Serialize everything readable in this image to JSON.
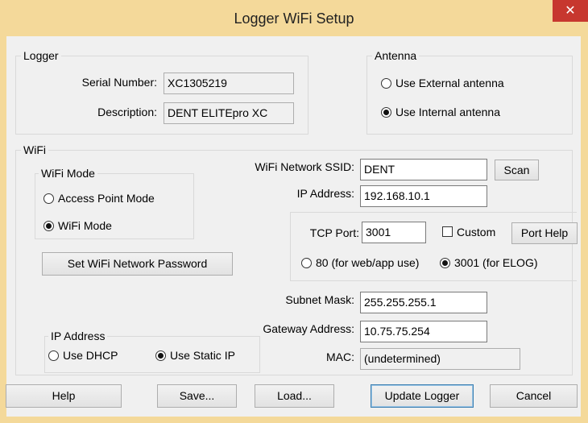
{
  "window": {
    "title": "Logger WiFi Setup",
    "close_glyph": "✕"
  },
  "logger": {
    "legend": "Logger",
    "serial_label": "Serial Number:",
    "serial_value": "XC1305219",
    "description_label": "Description:",
    "description_value": "DENT ELITEpro XC"
  },
  "antenna": {
    "legend": "Antenna",
    "options": [
      {
        "label": "Use External antenna",
        "selected": false
      },
      {
        "label": "Use Internal antenna",
        "selected": true
      }
    ]
  },
  "wifi": {
    "legend": "WiFi",
    "mode_legend": "WiFi Mode",
    "mode_options": [
      {
        "label": "Access Point Mode",
        "selected": false
      },
      {
        "label": "WiFi Mode",
        "selected": true
      }
    ],
    "set_password_button": "Set WiFi Network Password",
    "ssid_label": "WiFi Network SSID:",
    "ssid_value": "DENT",
    "scan_button": "Scan",
    "ip_label": "IP Address:",
    "ip_value": "192.168.10.1",
    "tcp_port_label": "TCP Port:",
    "tcp_port_value": "3001",
    "custom_label": "Custom",
    "custom_checked": false,
    "port_help_button": "Port Help",
    "port_options": [
      {
        "label": "80 (for web/app use)",
        "selected": false
      },
      {
        "label": "3001 (for ELOG)",
        "selected": true
      }
    ],
    "subnet_label": "Subnet Mask:",
    "subnet_value": "255.255.255.1",
    "gateway_label": "Gateway Address:",
    "gateway_value": "10.75.75.254",
    "mac_label": "MAC:",
    "mac_value": "(undetermined)",
    "ip_mode_legend": "IP Address",
    "ip_mode_options": [
      {
        "label": "Use DHCP",
        "selected": false
      },
      {
        "label": "Use Static IP",
        "selected": true
      }
    ]
  },
  "footer": {
    "help": "Help",
    "save": "Save...",
    "load": "Load...",
    "update": "Update Logger",
    "cancel": "Cancel"
  }
}
